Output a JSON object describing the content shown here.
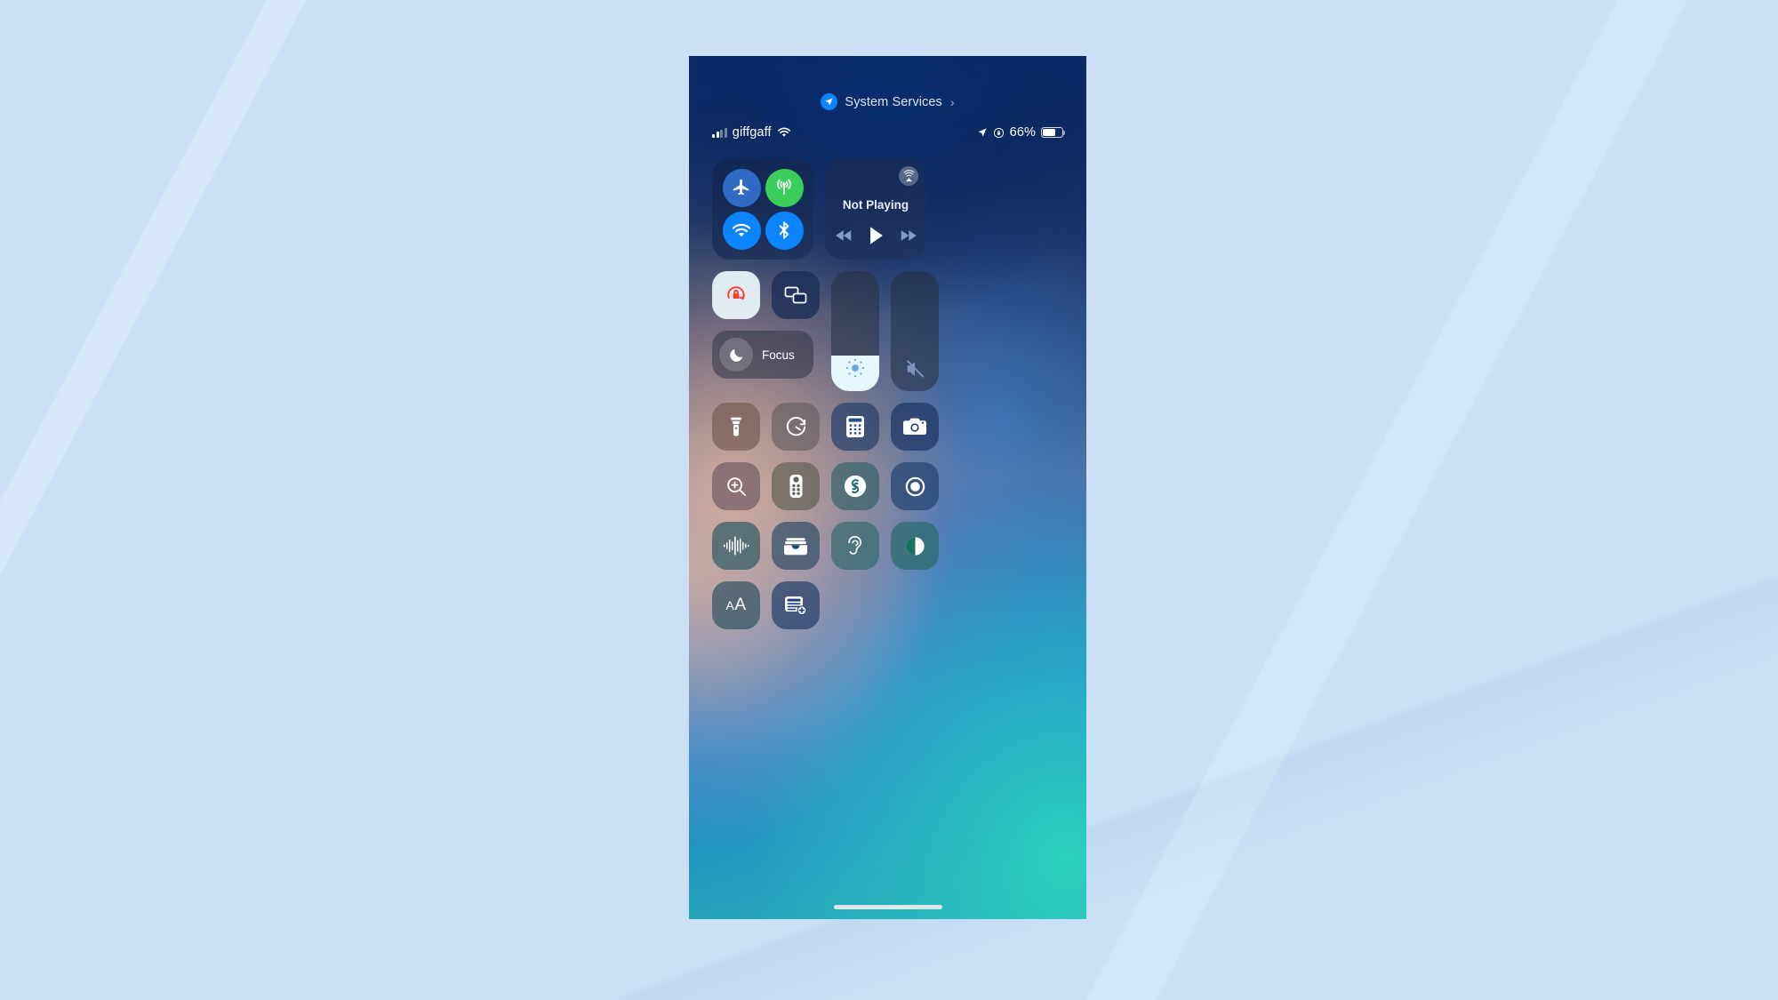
{
  "background": {
    "color": "#cbe0f7"
  },
  "phone": {
    "header": {
      "icon": "location-arrow-icon",
      "label": "System Services",
      "chevron": "›"
    },
    "status_bar": {
      "carrier": "giffgaff",
      "signal_icon": "cellular-bars-icon",
      "wifi_icon": "wifi-icon",
      "location_icon": "location-arrow-icon",
      "rotation_lock_icon": "rotation-lock-icon",
      "battery_percent": "66%",
      "battery_level": 66
    },
    "connectivity": {
      "label": "Connectivity",
      "buttons": [
        {
          "name": "airplane-mode",
          "label": "Airplane Mode",
          "state": "off",
          "color": "#2f6bc4"
        },
        {
          "name": "cellular-data",
          "label": "Cellular Data",
          "state": "on",
          "color": "#3acf5b"
        },
        {
          "name": "wifi",
          "label": "Wi-Fi",
          "state": "on",
          "color": "#0a84ff"
        },
        {
          "name": "bluetooth",
          "label": "Bluetooth",
          "state": "on",
          "color": "#0a84ff"
        }
      ]
    },
    "media": {
      "status": "Not Playing",
      "airplay_label": "AirPlay",
      "controls": [
        {
          "name": "rewind",
          "label": "Rewind"
        },
        {
          "name": "play",
          "label": "Play"
        },
        {
          "name": "fast-forward",
          "label": "Fast Forward"
        }
      ]
    },
    "rotation_lock": {
      "label": "Rotation Lock",
      "state": "on"
    },
    "screen_mirroring": {
      "label": "Screen Mirroring",
      "state": "off"
    },
    "focus": {
      "label": "Focus",
      "icon": "moon-icon",
      "state": "off"
    },
    "brightness": {
      "label": "Brightness",
      "value": 30
    },
    "volume": {
      "label": "Volume",
      "value": 0,
      "muted": true
    },
    "tiles": [
      {
        "name": "flashlight",
        "label": "Flashlight"
      },
      {
        "name": "timer",
        "label": "Timer"
      },
      {
        "name": "calculator",
        "label": "Calculator"
      },
      {
        "name": "camera",
        "label": "Camera"
      },
      {
        "name": "magnifier",
        "label": "Magnifier"
      },
      {
        "name": "apple-tv-remote",
        "label": "Apple TV Remote"
      },
      {
        "name": "shazam",
        "label": "Music Recognition"
      },
      {
        "name": "screen-recording",
        "label": "Screen Recording"
      },
      {
        "name": "sound-recognition",
        "label": "Sound Recognition"
      },
      {
        "name": "wallet",
        "label": "Wallet"
      },
      {
        "name": "hearing",
        "label": "Hearing"
      },
      {
        "name": "dark-mode",
        "label": "Dark Mode"
      },
      {
        "name": "text-size",
        "label": "Text Size",
        "text": "AA"
      },
      {
        "name": "quick-note",
        "label": "Quick Note"
      }
    ],
    "home_indicator": {
      "label": "Home Indicator"
    }
  }
}
